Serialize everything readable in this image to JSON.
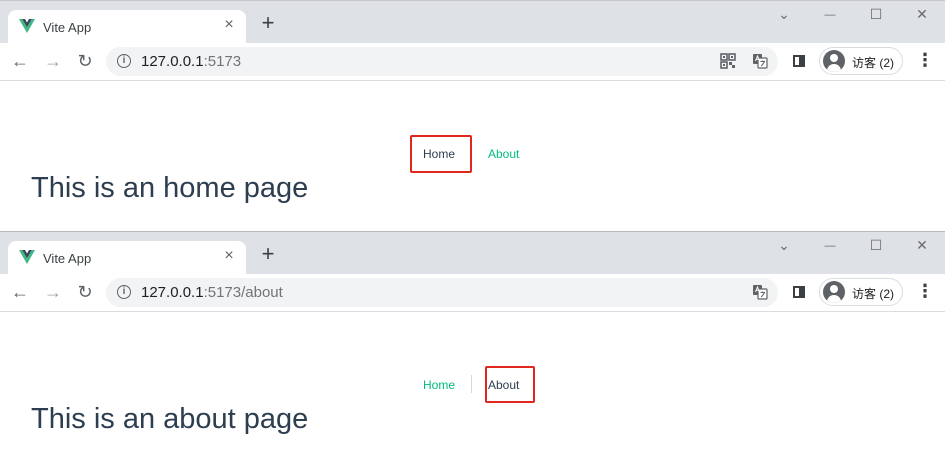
{
  "screens": [
    {
      "tab_title": "Vite App",
      "url_host": "127.0.0.1",
      "url_rest": ":5173",
      "profile_label": "访客 (2)",
      "nav": {
        "home": "Home",
        "about": "About",
        "active": "home"
      },
      "heading": "This is an home page"
    },
    {
      "tab_title": "Vite App",
      "url_host": "127.0.0.1",
      "url_rest": ":5173/about",
      "profile_label": "访客 (2)",
      "nav": {
        "home": "Home",
        "about": "About",
        "active": "about"
      },
      "heading": "This is an about page"
    }
  ],
  "glyphs": {
    "close": "×",
    "new_tab": "+",
    "back": "←",
    "forward": "→",
    "reload": "↻",
    "minimize": "—",
    "maximize": "☐",
    "window_close": "✕",
    "tabsearch": "⌄",
    "menu": "⋮",
    "info": "i"
  },
  "colors": {
    "link_active": "#2c3e50",
    "link_inactive": "#00bd7e",
    "highlight_box": "#e0281e",
    "vue_green": "#41b883",
    "vue_dark": "#35495e"
  },
  "icons": {
    "favicon": "vue-logo-icon",
    "qr": "qr-code-icon",
    "translate": "translate-icon",
    "sidepanel": "side-panel-icon",
    "avatar": "avatar-icon"
  }
}
